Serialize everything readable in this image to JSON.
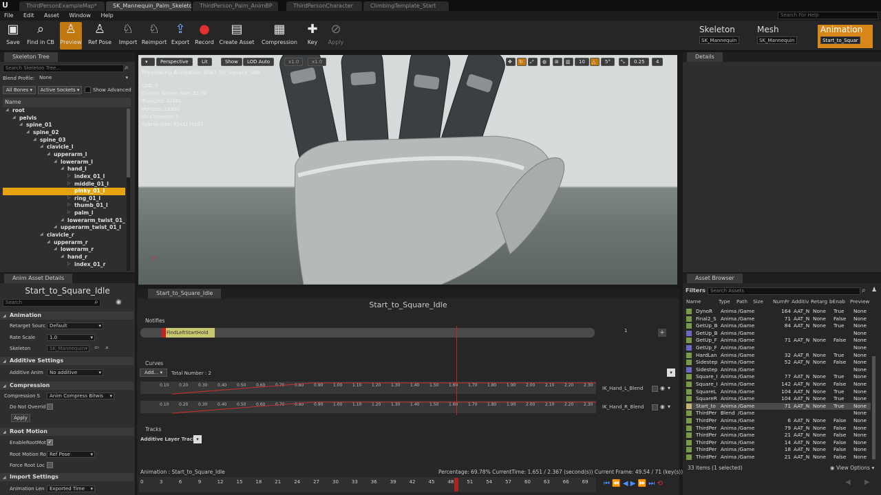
{
  "tabs": [
    "ThirdPersonExampleMap*",
    "SK_Mannequin_Palm_Skeleton",
    "ThirdPerson_Palm_AnimBP",
    "ThirdPersonCharacter",
    "ClimbingTemplate_Start"
  ],
  "menu": [
    "File",
    "Edit",
    "Asset",
    "Window",
    "Help"
  ],
  "search_help_placeholder": "Search For Help",
  "toolbar": {
    "buttons": [
      {
        "label": "Save",
        "icon": "save-icon"
      },
      {
        "label": "Find in CB",
        "icon": "find-icon"
      },
      {
        "label": "Preview",
        "icon": "preview-icon"
      },
      {
        "label": "Ref Pose",
        "icon": "refpose-icon"
      },
      {
        "label": "Import",
        "icon": "import-icon"
      },
      {
        "label": "Reimport",
        "icon": "reimport-icon"
      },
      {
        "label": "Export",
        "icon": "export-icon"
      },
      {
        "label": "Record",
        "icon": "record-icon"
      },
      {
        "label": "Create Asset",
        "icon": "create-asset-icon"
      },
      {
        "label": "Compression",
        "icon": "compression-icon"
      },
      {
        "label": "Key",
        "icon": "key-icon"
      },
      {
        "label": "Apply",
        "icon": "apply-icon"
      }
    ]
  },
  "modes": [
    {
      "label": "Skeleton",
      "value": "SK_Mannequin"
    },
    {
      "label": "Mesh",
      "value": "SK_Mannequin"
    },
    {
      "label": "Animation",
      "value": "Start_to_Squar"
    }
  ],
  "skeleton_tree": {
    "tab": "Skeleton Tree",
    "search_placeholder": "Search Skeleton Tree...",
    "blend_profile_label": "Blend Profile:",
    "blend_profile_value": "None",
    "all_bones": "All Bones",
    "active_sockets": "Active Sockets",
    "show_advanced": "Show Advanced",
    "name_header": "Name",
    "bones": [
      {
        "name": "root",
        "depth": 0,
        "selected": false
      },
      {
        "name": "pelvis",
        "depth": 1,
        "selected": false
      },
      {
        "name": "spine_01",
        "depth": 2,
        "selected": false
      },
      {
        "name": "spine_02",
        "depth": 3,
        "selected": false
      },
      {
        "name": "spine_03",
        "depth": 4,
        "selected": false
      },
      {
        "name": "clavicle_l",
        "depth": 5,
        "selected": false
      },
      {
        "name": "upperarm_l",
        "depth": 6,
        "selected": false
      },
      {
        "name": "lowerarm_l",
        "depth": 7,
        "selected": false
      },
      {
        "name": "hand_l",
        "depth": 8,
        "selected": false
      },
      {
        "name": "index_01_l",
        "depth": 9,
        "selected": false
      },
      {
        "name": "middle_01_l",
        "depth": 9,
        "selected": false
      },
      {
        "name": "pinky_01_l",
        "depth": 9,
        "selected": true
      },
      {
        "name": "ring_01_l",
        "depth": 9,
        "selected": false
      },
      {
        "name": "thumb_01_l",
        "depth": 9,
        "selected": false
      },
      {
        "name": "palm_l",
        "depth": 9,
        "selected": false
      },
      {
        "name": "lowerarm_twist_01_l",
        "depth": 8,
        "selected": false
      },
      {
        "name": "upperarm_twist_01_l",
        "depth": 7,
        "selected": false
      },
      {
        "name": "clavicle_r",
        "depth": 5,
        "selected": false
      },
      {
        "name": "upperarm_r",
        "depth": 6,
        "selected": false
      },
      {
        "name": "lowerarm_r",
        "depth": 7,
        "selected": false
      },
      {
        "name": "hand_r",
        "depth": 8,
        "selected": false
      },
      {
        "name": "index_01_r",
        "depth": 9,
        "selected": false
      }
    ]
  },
  "anim_details": {
    "tab": "Anim Asset Details",
    "asset_name": "Start_to_Square_Idle",
    "search_placeholder": "Search",
    "sections": {
      "animation": "Animation",
      "additive": "Additive Settings",
      "compression": "Compression",
      "root_motion": "Root Motion",
      "import": "Import Settings"
    },
    "retarget_label": "Retarget Sourc",
    "retarget_value": "Default",
    "rate_label": "Rate Scale",
    "rate_value": "1.0",
    "skeleton_label": "Skeleton",
    "skeleton_value": "SK_Mannequin",
    "additive_label": "Additive Anim",
    "additive_value": "No additive",
    "compression_label": "Compression S",
    "compression_value": "Anim Compress Bitwis",
    "do_not_override": "Do Not Overrid",
    "apply_label": "Apply",
    "enable_root": "EnableRootMot",
    "root_motion_label": "Root Motion Ro",
    "root_motion_value": "Ref Pose",
    "force_root": "Force Root Loc",
    "anim_length_label": "Animation Len",
    "anim_length_value": "Exported Time"
  },
  "viewport": {
    "perspective": "Perspective",
    "lit": "Lit",
    "show": "Show",
    "lod": "LOD Auto",
    "speed1": "x1.0",
    "speed2": "x1.0",
    "preview_text": "Previewing Animation Start_to_Square_Idle",
    "stats": [
      "LOD: 0",
      "Current Screen Size: 22.70",
      "Triangles: 41062",
      "Vertices: 23300",
      "UV Channels: 1",
      "Approx Size: 93x117x197"
    ],
    "grid_value": "10",
    "angle_value": "5°",
    "scale_value": "0.25",
    "cam_value": "4"
  },
  "timeline": {
    "tab": "Start_to_Square_Idle",
    "title": "Start_to_Square_Idle",
    "notifies": "Notifies",
    "notify_name": "FindLeftStartHold",
    "notify_track_num": "1",
    "curves": "Curves",
    "add_label": "Add...",
    "total_number": "Total Number : 2",
    "curve_ticks": [
      "0.10",
      "0.20",
      "0.30",
      "0.40",
      "0.50",
      "0.60",
      "0.70",
      "0.80",
      "0.90",
      "1.00",
      "1.10",
      "1.20",
      "1.30",
      "1.40",
      "1.50",
      "1.60",
      "1.70",
      "1.80",
      "1.90",
      "2.00",
      "2.10",
      "2.20",
      "2.30"
    ],
    "curve_names": [
      "IK_Hand_L_Blend",
      "IK_Hand_R_Blend"
    ],
    "tracks": "Tracks",
    "additive_tracks": "Additive Layer Tracks",
    "status_anim": "Animation :   Start_to_Square_Idle",
    "status_info": "Percentage:  69.78% CurrentTime:  1.651 / 2.367 (second(s)) Current Frame:  49.54 / 71 (key(s))",
    "frame_ticks": [
      "0",
      "3",
      "6",
      "9",
      "12",
      "15",
      "18",
      "21",
      "24",
      "27",
      "30",
      "33",
      "36",
      "39",
      "42",
      "45",
      "48",
      "51",
      "54",
      "57",
      "60",
      "63",
      "66",
      "69"
    ]
  },
  "details": {
    "tab": "Details"
  },
  "asset_browser": {
    "tab": "Asset Browser",
    "filters": "Filters",
    "search_placeholder": "Search Assets",
    "headers": [
      "Name",
      "Type",
      "Path",
      "Size",
      "NumFr",
      "Additiv",
      "Retarg",
      "bEnab",
      "Preview"
    ],
    "rows": [
      {
        "name": "DynoR",
        "type": "Anima",
        "path": "/Game",
        "size": "",
        "numfr": "164",
        "add": "AAT_N",
        "ret": "None",
        "en": "True",
        "prev": "None",
        "color": "#7a9a4a"
      },
      {
        "name": "Final2_S",
        "type": "Anima",
        "path": "/Game",
        "size": "",
        "numfr": "71",
        "add": "AAT_N",
        "ret": "None",
        "en": "False",
        "prev": "None",
        "color": "#7a9a4a"
      },
      {
        "name": "GetUp_B",
        "type": "Anima",
        "path": "/Game",
        "size": "",
        "numfr": "84",
        "add": "AAT_N",
        "ret": "None",
        "en": "True",
        "prev": "None",
        "color": "#7a9a4a"
      },
      {
        "name": "GetUp_B",
        "type": "Anima",
        "path": "/Game",
        "size": "",
        "numfr": "",
        "add": "",
        "ret": "",
        "en": "",
        "prev": "None",
        "color": "#6a6ac0"
      },
      {
        "name": "GetUp_F",
        "type": "Anima",
        "path": "/Game",
        "size": "",
        "numfr": "71",
        "add": "AAT_N",
        "ret": "None",
        "en": "False",
        "prev": "None",
        "color": "#7a9a4a"
      },
      {
        "name": "GetUp_F",
        "type": "Anima",
        "path": "/Game",
        "size": "",
        "numfr": "",
        "add": "",
        "ret": "",
        "en": "",
        "prev": "None",
        "color": "#6a6ac0"
      },
      {
        "name": "HardLan",
        "type": "Anima",
        "path": "/Game",
        "size": "",
        "numfr": "32",
        "add": "AAT_R",
        "ret": "None",
        "en": "True",
        "prev": "None",
        "color": "#7a9a4a"
      },
      {
        "name": "Sidestep",
        "type": "Anima",
        "path": "/Game",
        "size": "",
        "numfr": "52",
        "add": "AAT_N",
        "ret": "None",
        "en": "False",
        "prev": "None",
        "color": "#7a9a4a"
      },
      {
        "name": "Sidestep",
        "type": "Anima",
        "path": "/Game",
        "size": "",
        "numfr": "",
        "add": "",
        "ret": "",
        "en": "",
        "prev": "None",
        "color": "#6a6ac0"
      },
      {
        "name": "Square_I",
        "type": "Anima",
        "path": "/Game",
        "size": "",
        "numfr": "77",
        "add": "AAT_N",
        "ret": "None",
        "en": "True",
        "prev": "None",
        "color": "#7a9a4a"
      },
      {
        "name": "Square_I",
        "type": "Anima",
        "path": "/Game",
        "size": "",
        "numfr": "142",
        "add": "AAT_N",
        "ret": "None",
        "en": "False",
        "prev": "None",
        "color": "#7a9a4a"
      },
      {
        "name": "SquareL",
        "type": "Anima",
        "path": "/Game",
        "size": "",
        "numfr": "104",
        "add": "AAT_N",
        "ret": "None",
        "en": "True",
        "prev": "None",
        "color": "#7a9a4a"
      },
      {
        "name": "SquareR",
        "type": "Anima",
        "path": "/Game",
        "size": "",
        "numfr": "104",
        "add": "AAT_N",
        "ret": "None",
        "en": "True",
        "prev": "None",
        "color": "#7a9a4a"
      },
      {
        "name": "Start_to",
        "type": "Anima",
        "path": "/Game",
        "size": "",
        "numfr": "71",
        "add": "AAT_N",
        "ret": "None",
        "en": "True",
        "prev": "None",
        "color": "#c8b070",
        "selected": true
      },
      {
        "name": "ThirdPer",
        "type": "Blend",
        "path": "/Game",
        "size": "",
        "numfr": "",
        "add": "",
        "ret": "",
        "en": "",
        "prev": "None",
        "color": "#7a9a4a"
      },
      {
        "name": "ThirdPer",
        "type": "Anima",
        "path": "/Game",
        "size": "",
        "numfr": "6",
        "add": "AAT_N",
        "ret": "None",
        "en": "False",
        "prev": "None",
        "color": "#7a9a4a"
      },
      {
        "name": "ThirdPer",
        "type": "Anima",
        "path": "/Game",
        "size": "",
        "numfr": "79",
        "add": "AAT_N",
        "ret": "None",
        "en": "False",
        "prev": "None",
        "color": "#7a9a4a"
      },
      {
        "name": "ThirdPer",
        "type": "Anima",
        "path": "/Game",
        "size": "",
        "numfr": "21",
        "add": "AAT_N",
        "ret": "None",
        "en": "False",
        "prev": "None",
        "color": "#7a9a4a"
      },
      {
        "name": "ThirdPer",
        "type": "Anima",
        "path": "/Game",
        "size": "",
        "numfr": "14",
        "add": "AAT_N",
        "ret": "None",
        "en": "False",
        "prev": "None",
        "color": "#7a9a4a"
      },
      {
        "name": "ThirdPer",
        "type": "Anima",
        "path": "/Game",
        "size": "",
        "numfr": "18",
        "add": "AAT_N",
        "ret": "None",
        "en": "False",
        "prev": "None",
        "color": "#7a9a4a"
      },
      {
        "name": "ThirdPer",
        "type": "Anima",
        "path": "/Game",
        "size": "",
        "numfr": "21",
        "add": "AAT_N",
        "ret": "None",
        "en": "False",
        "prev": "None",
        "color": "#7a9a4a"
      }
    ],
    "footer": "33 items (1 selected)",
    "view_options": "View Options"
  },
  "colors": {
    "accent": "#d8881a",
    "selected_bone": "#e7a30e",
    "curve": "#c83030",
    "playhead": "#c82020"
  }
}
